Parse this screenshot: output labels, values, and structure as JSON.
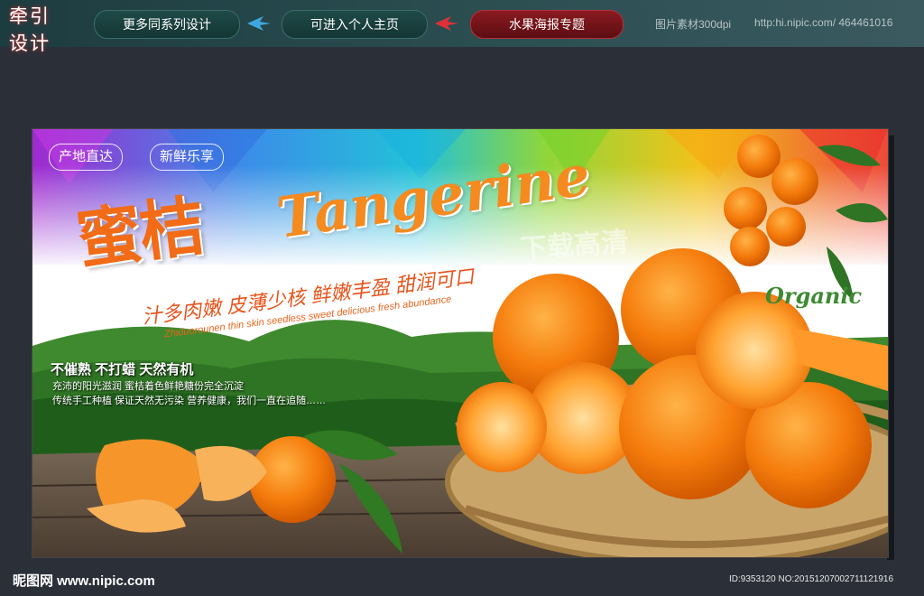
{
  "header": {
    "logo_line1": "牵引",
    "logo_line2": "设计",
    "nav": [
      {
        "label": "更多同系列设计"
      },
      {
        "label": "可进入个人主页"
      },
      {
        "label": "水果海报专题"
      }
    ],
    "meta_resolution": "图片素材300dpi",
    "meta_url": "http:hi.nipic.com/ 464461016"
  },
  "poster": {
    "badges": [
      "产地直达",
      "新鲜乐享"
    ],
    "title_cn": "蜜桔",
    "title_en": "Tangerine",
    "watermark": "下载高清",
    "features": "汁多肉嫩 皮薄少核 鲜嫩丰盈 甜润可口",
    "features_en": "Zhiduorounen thin skin seedless sweet delicious fresh abundance",
    "promo": "不催熟 不打蜡 天然有机",
    "desc_lines": [
      "充沛的阳光滋润 蜜桔着色鲜艳糖份完全沉淀",
      "传统手工种植 保证天然无污染 营养健康，我们一直在追随……"
    ],
    "organic": "Organic"
  },
  "footer": {
    "logo": "昵图网 www.nipic.com",
    "id": "ID:9353120 NO:20151207002711121916"
  },
  "colors": {
    "orange": "#f26b16",
    "dark_bg": "#2b3038",
    "teal_bar": "#1d3c40"
  }
}
